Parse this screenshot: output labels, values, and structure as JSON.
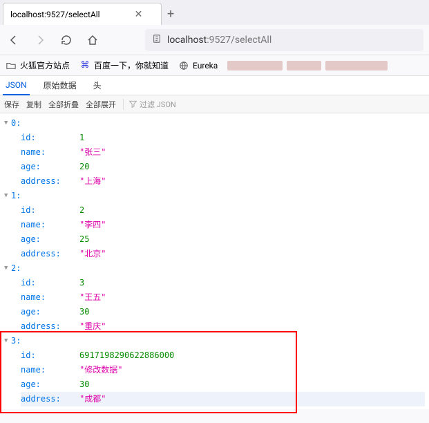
{
  "tab": {
    "title": "localhost:9527/selectAll"
  },
  "url": {
    "host": "localhost",
    "port": ":9527",
    "path": "/selectAll"
  },
  "bookmarks": {
    "b1": "火狐官方站点",
    "b2": "百度一下，你就知道",
    "b3": "Eureka"
  },
  "viewerTabs": {
    "json": "JSON",
    "raw": "原始数据",
    "headers": "头"
  },
  "toolbar": {
    "save": "保存",
    "copy": "复制",
    "collapse": "全部折叠",
    "expand": "全部展开",
    "filter": "过滤 JSON"
  },
  "tree": [
    {
      "idx": "0:",
      "id": "1",
      "name": "\"张三\"",
      "age": "20",
      "address": "\"上海\""
    },
    {
      "idx": "1:",
      "id": "2",
      "name": "\"李四\"",
      "age": "25",
      "address": "\"北京\""
    },
    {
      "idx": "2:",
      "id": "3",
      "name": "\"王五\"",
      "age": "30",
      "address": "\"重庆\""
    },
    {
      "idx": "3:",
      "id": "6917198290622886000",
      "name": "\"修改数据\"",
      "age": "30",
      "address": "\"成都\""
    }
  ],
  "keys": {
    "id": "id:",
    "name": "name:",
    "age": "age:",
    "address": "address:"
  },
  "chart_data": {
    "type": "table",
    "title": "JSON array response from localhost:9527/selectAll",
    "columns": [
      "id",
      "name",
      "age",
      "address"
    ],
    "rows": [
      {
        "id": 1,
        "name": "张三",
        "age": 20,
        "address": "上海"
      },
      {
        "id": 2,
        "name": "李四",
        "age": 25,
        "address": "北京"
      },
      {
        "id": 3,
        "name": "王五",
        "age": 30,
        "address": "重庆"
      },
      {
        "id": 6917198290622886000,
        "name": "修改数据",
        "age": 30,
        "address": "成都"
      }
    ]
  }
}
